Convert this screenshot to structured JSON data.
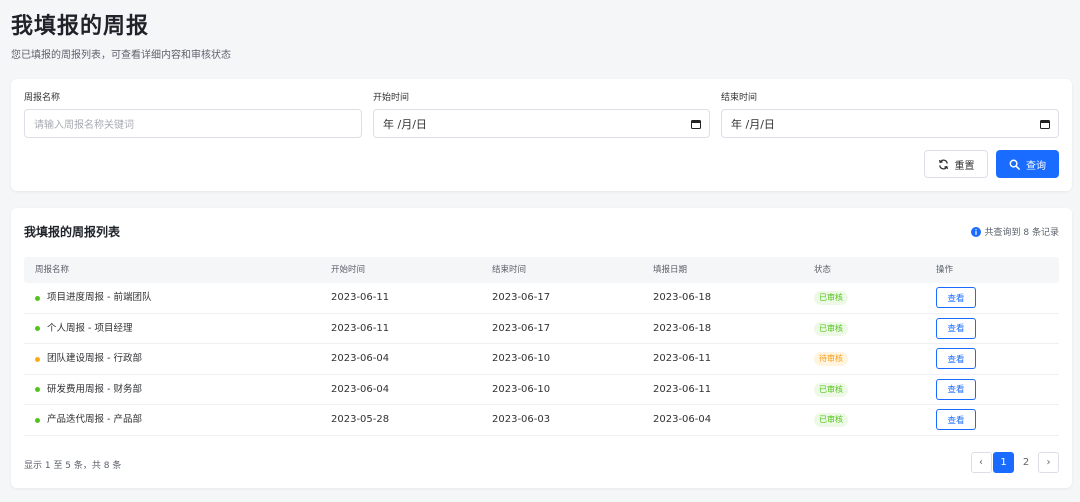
{
  "header": {
    "title": "我填报的周报",
    "subtitle": "您已填报的周报列表，可查看详细内容和审核状态"
  },
  "filters": {
    "name_label": "周报名称",
    "name_placeholder": "请输入周报名称关键词",
    "start_label": "开始时间",
    "start_value": "年 /月/日",
    "end_label": "结束时间",
    "end_value": "年 /月/日",
    "reset_label": "重置",
    "query_label": "查询"
  },
  "list": {
    "title": "我填报的周报列表",
    "record_count": "共查询到 8 条记录",
    "columns": [
      "周报名称",
      "开始时间",
      "结束时间",
      "填报日期",
      "状态",
      "操作"
    ],
    "rows": [
      {
        "name": "项目进度周报 - 前端团队",
        "start": "2023-06-11",
        "end": "2023-06-17",
        "filed": "2023-06-18",
        "status": "已审核",
        "status_type": "approved",
        "action": "查看"
      },
      {
        "name": "个人周报 - 项目经理",
        "start": "2023-06-11",
        "end": "2023-06-17",
        "filed": "2023-06-18",
        "status": "已审核",
        "status_type": "approved",
        "action": "查看"
      },
      {
        "name": "团队建设周报 - 行政部",
        "start": "2023-06-04",
        "end": "2023-06-10",
        "filed": "2023-06-11",
        "status": "待审核",
        "status_type": "pending",
        "action": "查看"
      },
      {
        "name": "研发费用周报 - 财务部",
        "start": "2023-06-04",
        "end": "2023-06-10",
        "filed": "2023-06-11",
        "status": "已审核",
        "status_type": "approved",
        "action": "查看"
      },
      {
        "name": "产品迭代周报 - 产品部",
        "start": "2023-05-28",
        "end": "2023-06-03",
        "filed": "2023-06-04",
        "status": "已审核",
        "status_type": "approved",
        "action": "查看"
      }
    ],
    "footer_info": "显示 1 至 5 条，共 8 条",
    "pagination": {
      "prev": "‹",
      "pages": [
        "1",
        "2"
      ],
      "current": "1",
      "next": "›"
    }
  },
  "colors": {
    "primary": "#1a6bff",
    "approved_dot": "#52c41a",
    "approved_text": "#52c41a",
    "approved_bg": "#edf9e6",
    "pending_dot": "#faad14",
    "pending_text": "#fa9d14",
    "pending_bg": "#fff4e0"
  }
}
